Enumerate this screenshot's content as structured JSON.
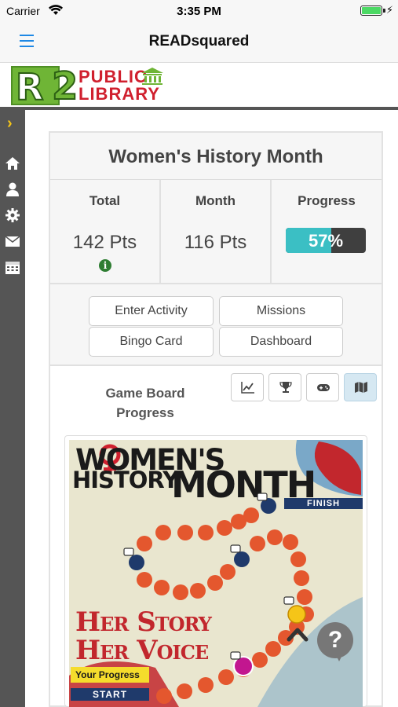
{
  "status_bar": {
    "carrier": "Carrier",
    "time": "3:35 PM",
    "battery_color": "#4cd964"
  },
  "nav": {
    "title": "READsquared",
    "menu_icon": "hamburger-icon",
    "accent_color": "#1e88e5"
  },
  "brand": {
    "logo_letter": "R",
    "logo_number": "2",
    "public": "PUBLIC",
    "library": "LIBRARY",
    "brand_green": "#6fb536",
    "brand_red": "#d0202e"
  },
  "sidebar": {
    "items": [
      {
        "icon": "chevron-right-icon"
      },
      {
        "icon": "home-icon"
      },
      {
        "icon": "user-icon"
      },
      {
        "icon": "gear-icon"
      },
      {
        "icon": "envelope-icon"
      },
      {
        "icon": "calendar-icon"
      }
    ]
  },
  "program": {
    "title": "Women's History Month",
    "stats": {
      "total_label": "Total",
      "total_value": "142 Pts",
      "month_label": "Month",
      "month_value": "116 Pts",
      "progress_label": "Progress",
      "progress_text": "57%",
      "progress_fraction": 0.57
    },
    "buttons": {
      "enter_activity": "Enter Activity",
      "missions": "Missions",
      "bingo_card": "Bingo Card",
      "dashboard": "Dashboard"
    },
    "game_board": {
      "title": "Game Board Progress",
      "views": [
        {
          "icon": "line-chart-icon",
          "active": false
        },
        {
          "icon": "trophy-icon",
          "active": false
        },
        {
          "icon": "gamepad-icon",
          "active": false
        },
        {
          "icon": "map-icon",
          "active": true
        }
      ],
      "board": {
        "title_line1": "WOMEN'S",
        "title_line2": "HISTORY",
        "title_line3": "MONTH",
        "finish": "FINISH",
        "her_story": "Her Story",
        "her_voice": "Her Voice",
        "your_progress": "Your Progress",
        "start": "START",
        "space_color": "#e4572e",
        "checkpoint_color": "#1f3a6b"
      }
    }
  },
  "help": {
    "label": "?"
  }
}
